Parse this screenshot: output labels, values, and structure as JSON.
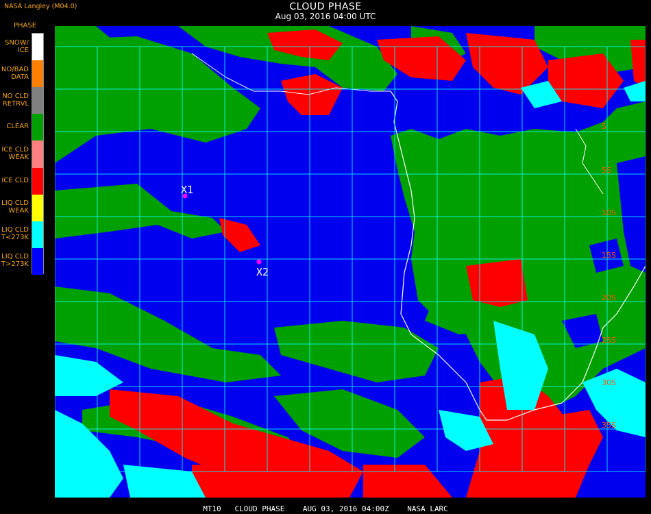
{
  "header": {
    "title": "CLOUD PHASE",
    "datetime": "Aug 03, 2016 04:00 UTC",
    "agency": "NASA Langley (M04.0)",
    "legend_title": "PHASE"
  },
  "legend": [
    {
      "label": "SNOW/\nICE",
      "color": "#ffffff"
    },
    {
      "label": "NO/BAD\nDATA",
      "color": "#ff8000"
    },
    {
      "label": "NO CLD\nRETRVL",
      "color": "#808080"
    },
    {
      "label": "CLEAR",
      "color": "#00a000"
    },
    {
      "label": "ICE CLD\nWEAK",
      "color": "#ff8080"
    },
    {
      "label": "ICE CLD",
      "color": "#ff0000"
    },
    {
      "label": "LIQ CLD\nWEAK",
      "color": "#ffff00"
    },
    {
      "label": "LIQ CLD\nT<273K",
      "color": "#00ffff"
    },
    {
      "label": "LIQ CLD\nT>273K",
      "color": "#0000ff"
    }
  ],
  "map": {
    "markers": [
      {
        "label": "X1",
        "color": "#ff00ff"
      },
      {
        "label": "X2",
        "color": "#ff00ff"
      }
    ],
    "lat_labels": [
      "5",
      "5S",
      "10S",
      "15S",
      "20S",
      "25S",
      "30S",
      "35S"
    ],
    "grid_color": "#00ffff",
    "coast_color": "#ffffff"
  },
  "footer": "MT10   CLOUD PHASE    AUG 03, 2016 04:00Z    NASA LARC"
}
